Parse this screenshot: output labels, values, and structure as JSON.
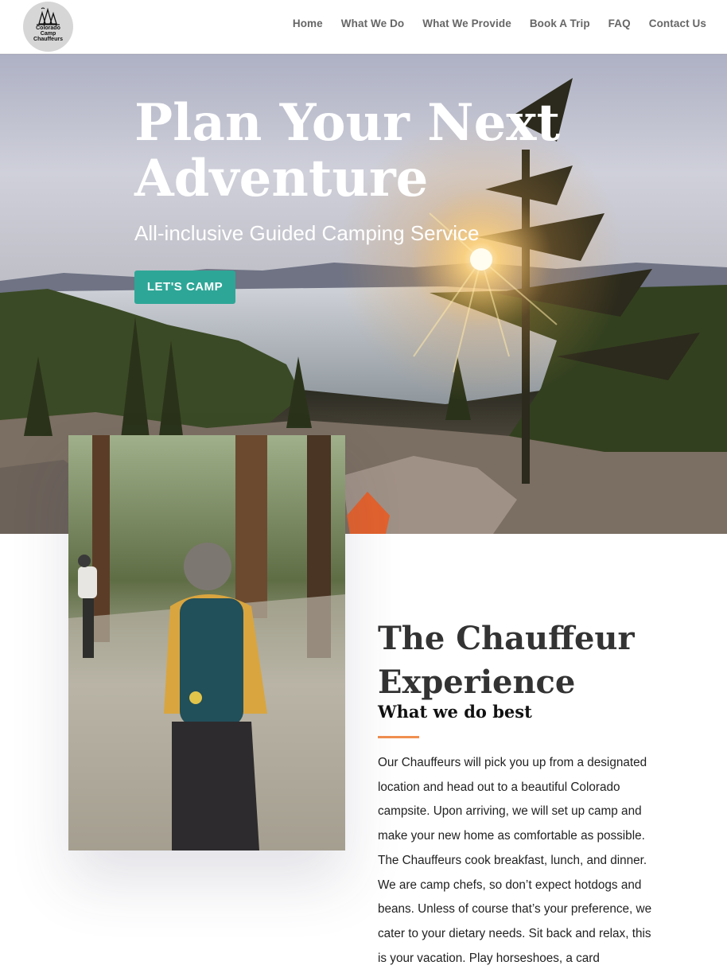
{
  "logo": {
    "lines": [
      "Colorado",
      "Camp",
      "Chauffeurs"
    ]
  },
  "nav": {
    "items": [
      "Home",
      "What We Do",
      "What We Provide",
      "Book A Trip",
      "FAQ",
      "Contact Us"
    ]
  },
  "hero": {
    "title": "Plan Your Next Adventure",
    "subtitle": "All-inclusive Guided Camping Service",
    "cta_label": "LET'S CAMP"
  },
  "section": {
    "title": "The Chauffeur Experience",
    "subtitle": "What we do best",
    "body": "Our Chauffeurs will pick you up from a designated location and head out to a beautiful Colorado campsite. Upon arriving, we will set up camp and make your new home as comfortable as possible. The Chauffeurs cook breakfast, lunch, and dinner. We are camp chefs, so don’t expect hotdogs and beans. Unless of course that’s your preference, we cater to your dietary needs. Sit back and relax, this is your vacation. Play horseshoes, a card"
  },
  "colors": {
    "accent_teal": "#2ea697",
    "accent_orange": "#f08f4f",
    "nav_text": "#666666"
  }
}
